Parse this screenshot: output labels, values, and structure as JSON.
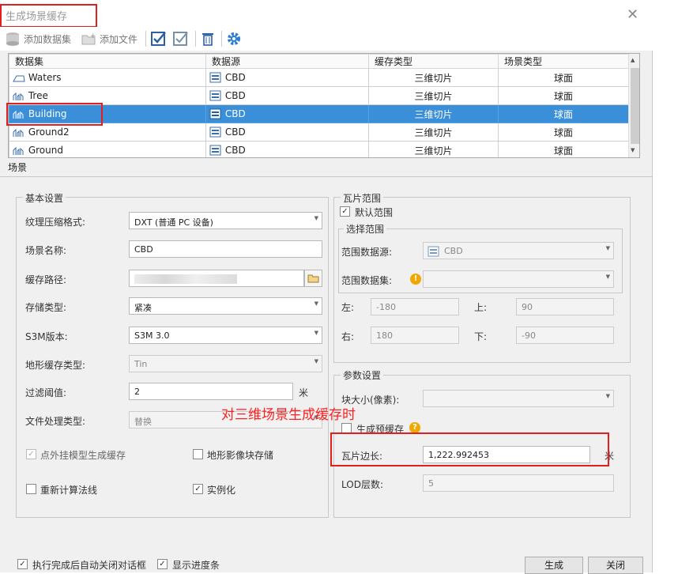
{
  "window": {
    "title": "生成场景缓存",
    "close_glyph": "✕"
  },
  "toolbar": {
    "add_dataset": "添加数据集",
    "add_file": "添加文件"
  },
  "grid": {
    "headers": [
      "数据集",
      "数据源",
      "缓存类型",
      "场景类型"
    ],
    "rows": [
      {
        "name": "Waters",
        "source": "CBD",
        "cache_type": "三维切片",
        "scene_type": "球面",
        "icon": "region-dataset-icon"
      },
      {
        "name": "Tree",
        "source": "CBD",
        "cache_type": "三维切片",
        "scene_type": "球面",
        "icon": "model-dataset-icon"
      },
      {
        "name": "Building",
        "source": "CBD",
        "cache_type": "三维切片",
        "scene_type": "球面",
        "icon": "model-dataset-icon",
        "selected": true
      },
      {
        "name": "Ground2",
        "source": "CBD",
        "cache_type": "三维切片",
        "scene_type": "球面",
        "icon": "model-dataset-icon"
      },
      {
        "name": "Ground",
        "source": "CBD",
        "cache_type": "三维切片",
        "scene_type": "球面",
        "icon": "model-dataset-icon"
      }
    ]
  },
  "tab": {
    "scene": "场景"
  },
  "basic": {
    "title": "基本设置",
    "texture_label": "纹理压缩格式:",
    "texture_value": "DXT (普通 PC 设备)",
    "scene_name_label": "场景名称:",
    "scene_name_value": "CBD",
    "cache_path_label": "缓存路径:",
    "storage_label": "存储类型:",
    "storage_value": "紧凑",
    "s3m_label": "S3M版本:",
    "s3m_value": "S3M 3.0",
    "terrain_label": "地形缓存类型:",
    "terrain_value": "Tin",
    "filter_label": "过滤阈值:",
    "filter_value": "2",
    "filter_unit": "米",
    "file_label": "文件处理类型:",
    "file_value": "替换",
    "pointcache_label": "点外挂模型生成缓存",
    "terrain_image_label": "地形影像块存储",
    "recompute_label": "重新计算法线",
    "instancing_label": "实例化"
  },
  "tile_range": {
    "title": "瓦片范围",
    "default_label": "默认范围",
    "select_title": "选择范围",
    "source_label": "范围数据源:",
    "source_value": "CBD",
    "dataset_label": "范围数据集:",
    "left_label": "左:",
    "left_value": "-180",
    "top_label": "上:",
    "top_value": "90",
    "right_label": "右:",
    "right_value": "180",
    "bottom_label": "下:",
    "bottom_value": "-90"
  },
  "params": {
    "title": "参数设置",
    "block_label": "块大小(像素):",
    "precache_label": "生成预缓存",
    "tile_len_label": "瓦片边长:",
    "tile_len_value": "1,222.992453",
    "tile_len_unit": "米",
    "lod_label": "LOD层数:",
    "lod_value": "5"
  },
  "annotation": "对三维场景生成缓存时",
  "footer": {
    "autoclose_label": "执行完成后自动关闭对话框",
    "progress_label": "显示进度条",
    "generate": "生成",
    "close": "关闭"
  },
  "colors": {
    "selection": "#3a8fd8",
    "highlight": "#e02020",
    "accent": "#2b7cd3"
  }
}
